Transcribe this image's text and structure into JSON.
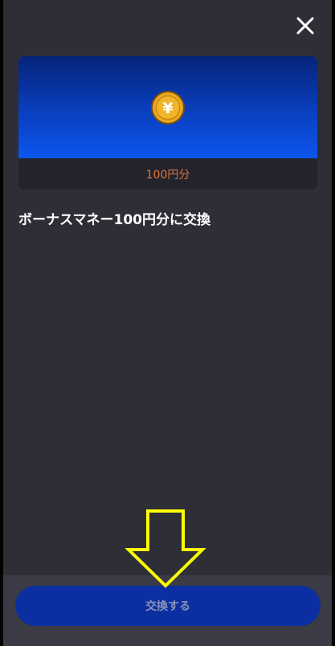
{
  "dialog": {
    "close_icon": "close-icon"
  },
  "reward_card": {
    "coin_icon": "yen-coin-icon",
    "coin_symbol": "¥",
    "price_label": "100円分",
    "colors": {
      "gradient_top": "#06237a",
      "gradient_bottom": "#0d56ee",
      "price_text": "#e0733f"
    }
  },
  "title": "ボーナスマネー100円分に交換",
  "annotation": {
    "arrow_icon": "down-arrow-icon",
    "color": "#ffff00"
  },
  "footer": {
    "exchange_button_label": "交換する",
    "button_color": "#0b2fa1"
  }
}
